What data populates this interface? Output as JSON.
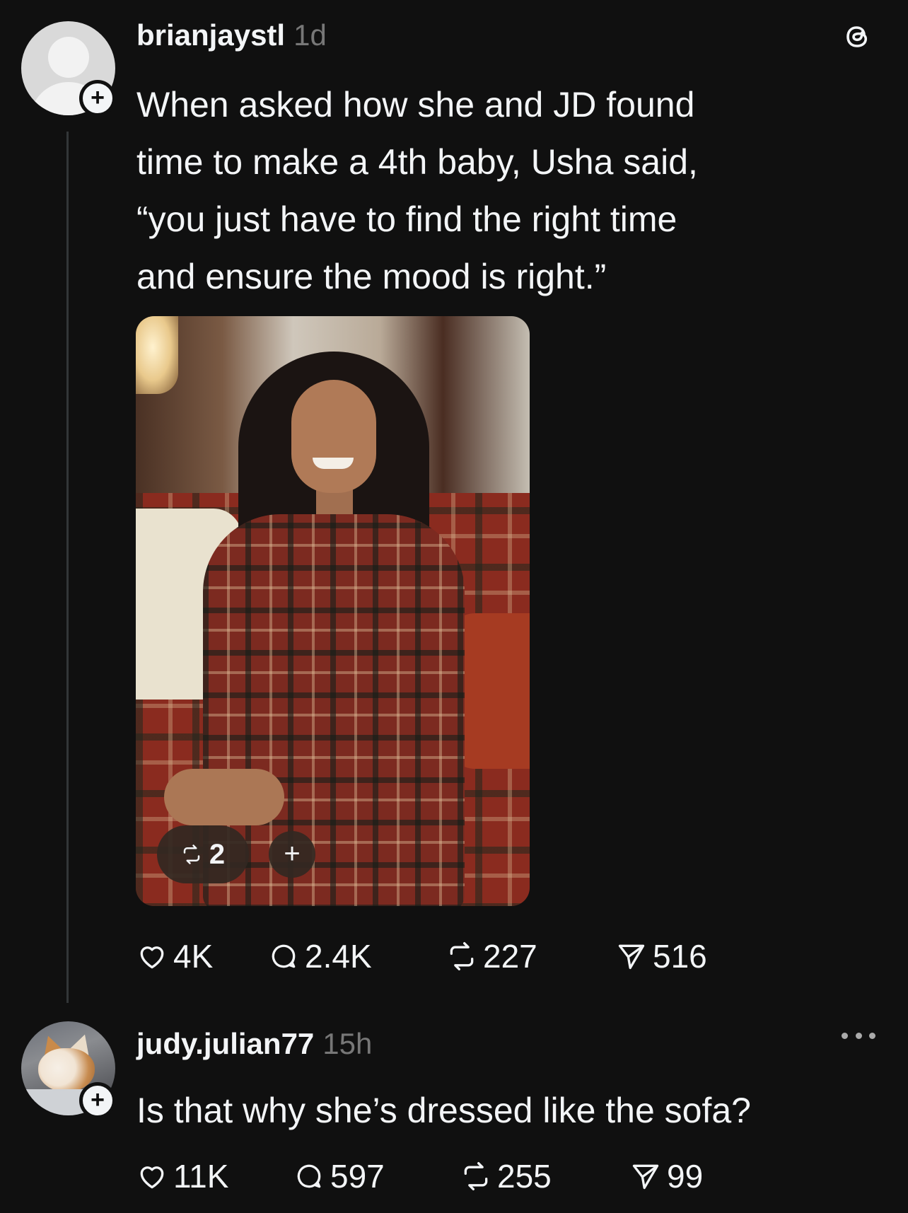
{
  "post": {
    "username": "brianjaystl",
    "time": "1d",
    "text_lines": [
      "When asked how she and JD found",
      "time to make a 4th baby, Usha said,",
      "“you just have to find the right time",
      "and ensure the mood is right.”"
    ],
    "image_repost_count": "2",
    "image_plus": "+",
    "follow_symbol": "+",
    "stats": {
      "likes": "4K",
      "replies": "2.4K",
      "reposts": "227",
      "shares": "516"
    }
  },
  "reply": {
    "username": "judy.julian77",
    "time": "15h",
    "text": "Is that why she’s dressed like the sofa?",
    "follow_symbol": "+",
    "stats": {
      "likes": "11K",
      "replies": "597",
      "reposts": "255",
      "shares": "99"
    }
  },
  "icons": {
    "app_logo": "threads-logo-icon",
    "like": "heart-icon",
    "reply": "comment-icon",
    "repost": "repost-icon",
    "share": "send-icon",
    "more": "more-icon"
  },
  "colors": {
    "background": "#101010",
    "text": "#f3f5f7",
    "muted": "#777777",
    "thread_line": "#333638"
  }
}
